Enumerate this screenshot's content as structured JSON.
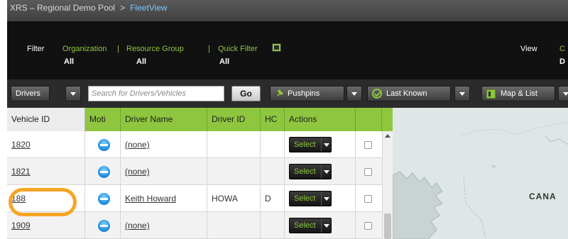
{
  "breadcrumb": {
    "root": "XRS – Regional Demo Pool",
    "separator": ">",
    "current": "FleetView"
  },
  "filter": {
    "label": "Filter",
    "organization": {
      "label": "Organization",
      "value": "All"
    },
    "resource_group": {
      "label": "Resource Group",
      "value": "All"
    },
    "quick_filter": {
      "label": "Quick Filter",
      "value": "All"
    },
    "view": {
      "label": "View",
      "value_partial": "D",
      "link_partial": "C"
    }
  },
  "toolbar": {
    "drivers_label": "Drivers",
    "search_placeholder": "Search for Drivers/Vehicles",
    "go_label": "Go",
    "pushpins_label": "Pushpins",
    "last_known_label": "Last Known",
    "map_list_label": "Map & List"
  },
  "grid": {
    "columns": [
      "Vehicle ID",
      "Moti",
      "Driver Name",
      "Driver ID",
      "HC",
      "Actions"
    ],
    "select_label": "Select",
    "rows": [
      {
        "vehicle_id": "1820",
        "driver_name": "(none)",
        "driver_id": "",
        "hc": ""
      },
      {
        "vehicle_id": "1821",
        "driver_name": "(none)",
        "driver_id": "",
        "hc": ""
      },
      {
        "vehicle_id": "188",
        "driver_name": "Keith Howard",
        "driver_id": "HOWA",
        "hc": "D"
      },
      {
        "vehicle_id": "1909",
        "driver_name": "(none)",
        "driver_id": "",
        "hc": ""
      }
    ]
  },
  "map": {
    "label": "CANA"
  },
  "colors": {
    "accent_green": "#8ec63f",
    "highlight_orange": "#f5a623",
    "status_blue": "#1a86d6"
  }
}
